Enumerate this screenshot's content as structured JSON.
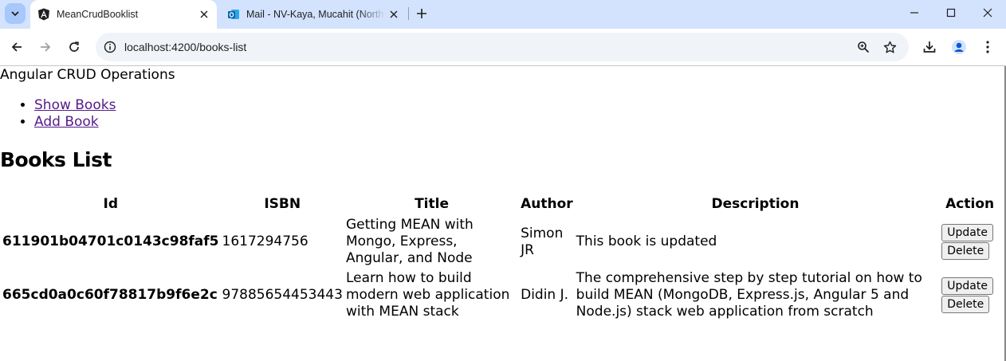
{
  "browser": {
    "tabs": [
      {
        "title": "MeanCrudBooklist",
        "icon": "angular-icon",
        "active": true
      },
      {
        "title": "Mail - NV-Kaya, Mucahit (North",
        "icon": "outlook-icon",
        "active": false
      }
    ],
    "url_host": "localhost",
    "url_port_path": ":4200/books-list",
    "accent": "#d3e3fd"
  },
  "page": {
    "app_title": "Angular CRUD Operations",
    "nav": [
      {
        "label": "Show Books"
      },
      {
        "label": "Add Book"
      }
    ],
    "heading": "Books List",
    "table": {
      "headers": [
        "Id",
        "ISBN",
        "Title",
        "Author",
        "Description",
        "Action"
      ],
      "rows": [
        {
          "id": "611901b04701c0143c98faf5",
          "isbn": "1617294756",
          "title": "Getting MEAN with Mongo, Express, Angular, and Node",
          "author": "Simon JR",
          "description": "This book is updated",
          "update": "Update",
          "delete": "Delete"
        },
        {
          "id": "665cd0a0c60f78817b9f6e2c",
          "isbn": "97885654453443",
          "title": "Learn how to build modern web application with MEAN stack",
          "author": "Didin J.",
          "description": "The comprehensive step by step tutorial on how to build MEAN (MongoDB, Express.js, Angular 5 and Node.js) stack web application from scratch",
          "update": "Update",
          "delete": "Delete"
        }
      ]
    }
  }
}
